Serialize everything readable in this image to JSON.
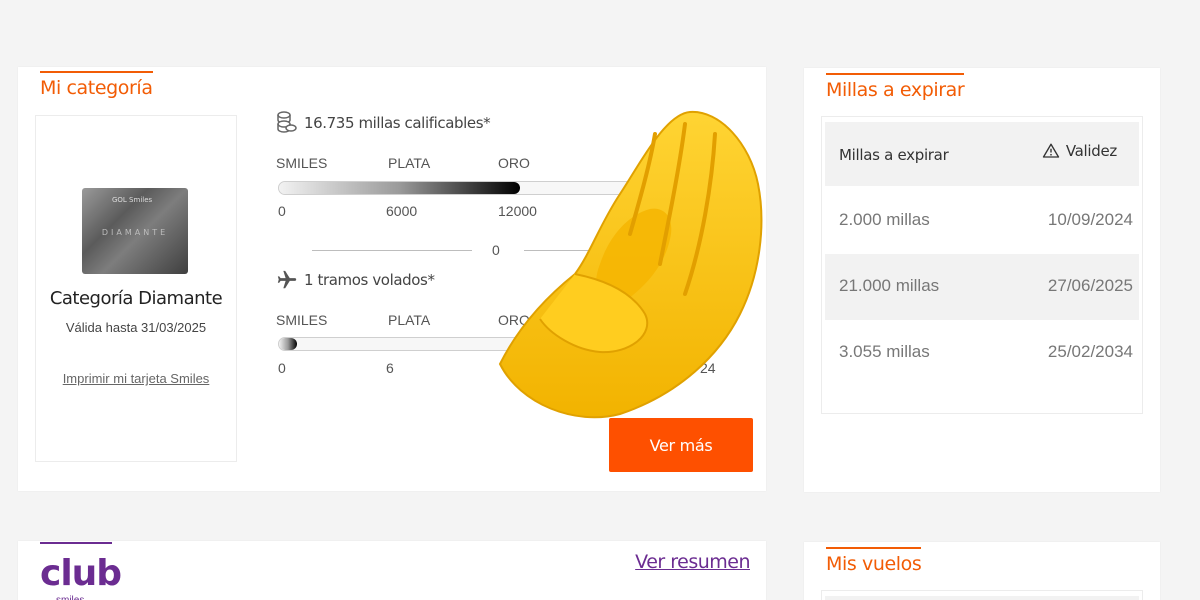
{
  "category": {
    "title": "Mi categoría",
    "card_brand": "GOL Smiles",
    "card_tier_word": "DIAMANTE",
    "tier_name": "Categoría Diamante",
    "valid_until": "Válida hasta 31/03/2025",
    "print_link": "Imprimir mi tarjeta Smiles",
    "miles": {
      "label": "16.735 millas calificables*",
      "icon": "coins-icon",
      "levels": [
        "SMILES",
        "PLATA",
        "ORO"
      ],
      "ticks": [
        "0",
        "6000",
        "12000"
      ],
      "progress_fraction": 0.55
    },
    "divider_text": "0",
    "segments": {
      "label": "1 tramos volados*",
      "icon": "airplane-icon",
      "levels": [
        "SMILES",
        "PLATA",
        "ORO"
      ],
      "ticks": [
        "0",
        "6",
        "24"
      ],
      "progress_fraction": 0.04
    },
    "more_button": "Ver más",
    "accent_color": "#fe5000"
  },
  "expiring": {
    "title": "Millas a expirar",
    "col_miles": "Millas a expirar",
    "col_validity": "Validez",
    "col_validity_icon": "warning-icon",
    "rows": [
      {
        "amount": "2.000 millas",
        "date": "10/09/2024"
      },
      {
        "amount": "21.000 millas",
        "date": "27/06/2025"
      },
      {
        "amount": "3.055 millas",
        "date": "25/02/2034"
      }
    ]
  },
  "club": {
    "logo": "club",
    "logo_sub": "smiles",
    "summary_link": "Ver resumen",
    "brand_color": "#6b2c91"
  },
  "flights": {
    "title": "Mis vuelos"
  },
  "overlay": {
    "emoji": "pinched-fingers-hand"
  }
}
